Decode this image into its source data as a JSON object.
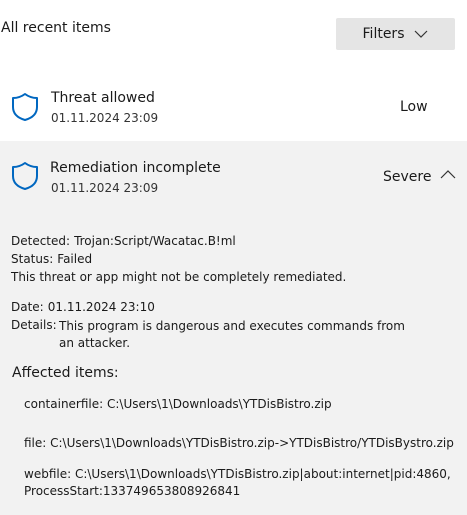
{
  "header": {
    "title": "All recent items",
    "filters_label": "Filters"
  },
  "items": [
    {
      "title": "Threat allowed",
      "date": "01.11.2024 23:09",
      "severity": "Low"
    },
    {
      "title": "Remediation incomplete",
      "date": "01.11.2024 23:09",
      "severity": "Severe",
      "expanded": true,
      "details": {
        "detected_label": "Detected:",
        "detected_value": "Trojan:Script/Wacatac.B!ml",
        "status_label": "Status:",
        "status_value": "Failed",
        "status_note": "This threat or app might not be completely remediated.",
        "date_label": "Date:",
        "date_value": "01.11.2024 23:10",
        "details_label": "Details:",
        "details_value": "This program is dangerous and executes commands from an attacker.",
        "affected_title": "Affected items:",
        "affected": [
          "containerfile: C:\\Users\\1\\Downloads\\YTDisBistro.zip",
          "file: C:\\Users\\1\\Downloads\\YTDisBistro.zip->YTDisBistro/YTDisBystro.zip",
          "webfile: C:\\Users\\1\\Downloads\\YTDisBistro.zip|about:internet|pid:4860,ProcessStart:133749653808926841"
        ]
      }
    }
  ],
  "colors": {
    "accent": "#0067c0",
    "expanded_bg": "#f2f2f2",
    "button_bg": "#e5e5e5"
  },
  "icons": {
    "shield": "shield-icon",
    "filters": "chevron-down-icon",
    "collapse": "chevron-up-icon"
  }
}
